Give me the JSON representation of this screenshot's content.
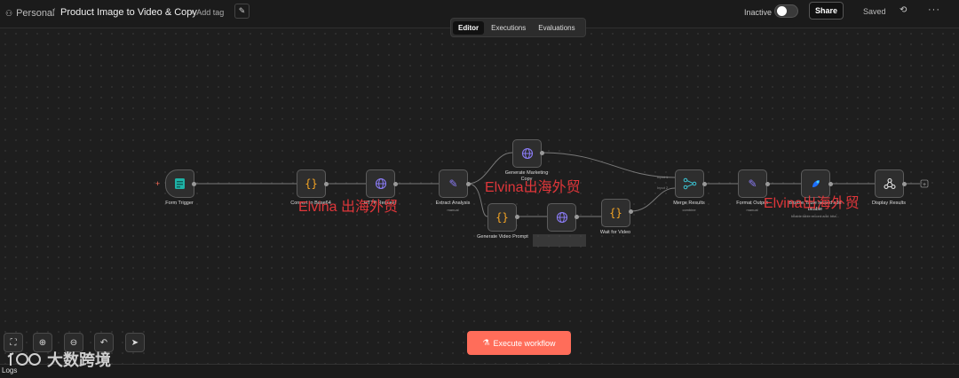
{
  "header": {
    "owner": "Personal",
    "separator": "/",
    "workflow_name": "Product Image to Video & Copy",
    "add_tag": "+ Add tag",
    "status_label": "Inactive",
    "share_label": "Share",
    "saved_label": "Saved"
  },
  "tabs": [
    {
      "label": "Editor",
      "active": true
    },
    {
      "label": "Executions",
      "active": false
    },
    {
      "label": "Evaluations",
      "active": false
    }
  ],
  "nodes": {
    "form_trigger": {
      "label": "Form Trigger"
    },
    "convert_base64": {
      "label": "Convert to Base64"
    },
    "http_request": {
      "label": "HTTP Request"
    },
    "extract_analysis": {
      "label": "Extract Analysis",
      "sub": "manual"
    },
    "generate_marketing": {
      "label": "Generate Marketing",
      "label2": "Copy"
    },
    "generate_video_prompt": {
      "label": "Generate Video Prompt"
    },
    "video_request": {
      "label": "HTTP Request"
    },
    "wait_video": {
      "label": "Wait for Video"
    },
    "merge_results": {
      "label": "Merge Results",
      "sub": "combine",
      "input1": "Input 1",
      "input2": "Input 2"
    },
    "format_output": {
      "label": "Format Output",
      "sub": "manual"
    },
    "bitable": {
      "label": "Bitable Table record add",
      "label2": "bitable",
      "sub": "bitable:table:record:add: bita..."
    },
    "display_results": {
      "label": "Display Results"
    }
  },
  "watermarks": {
    "w1": "Elvina 出海外贸",
    "w2": "Elvina出海外贸",
    "w3": "Elvina出海外贸",
    "logo": "大数跨境"
  },
  "execute_label": "Execute workflow",
  "logs_label": "Logs",
  "colors": {
    "accent": "#ff6d5a",
    "background": "#1e1e1e",
    "watermark": "#e0363a",
    "trigger_icon": "#1fb2a6",
    "code_icon": "#f5a524",
    "http_icon": "#8b7cf6",
    "edit_icon": "#8b7cf6",
    "merge_icon": "#3bc6d6"
  }
}
